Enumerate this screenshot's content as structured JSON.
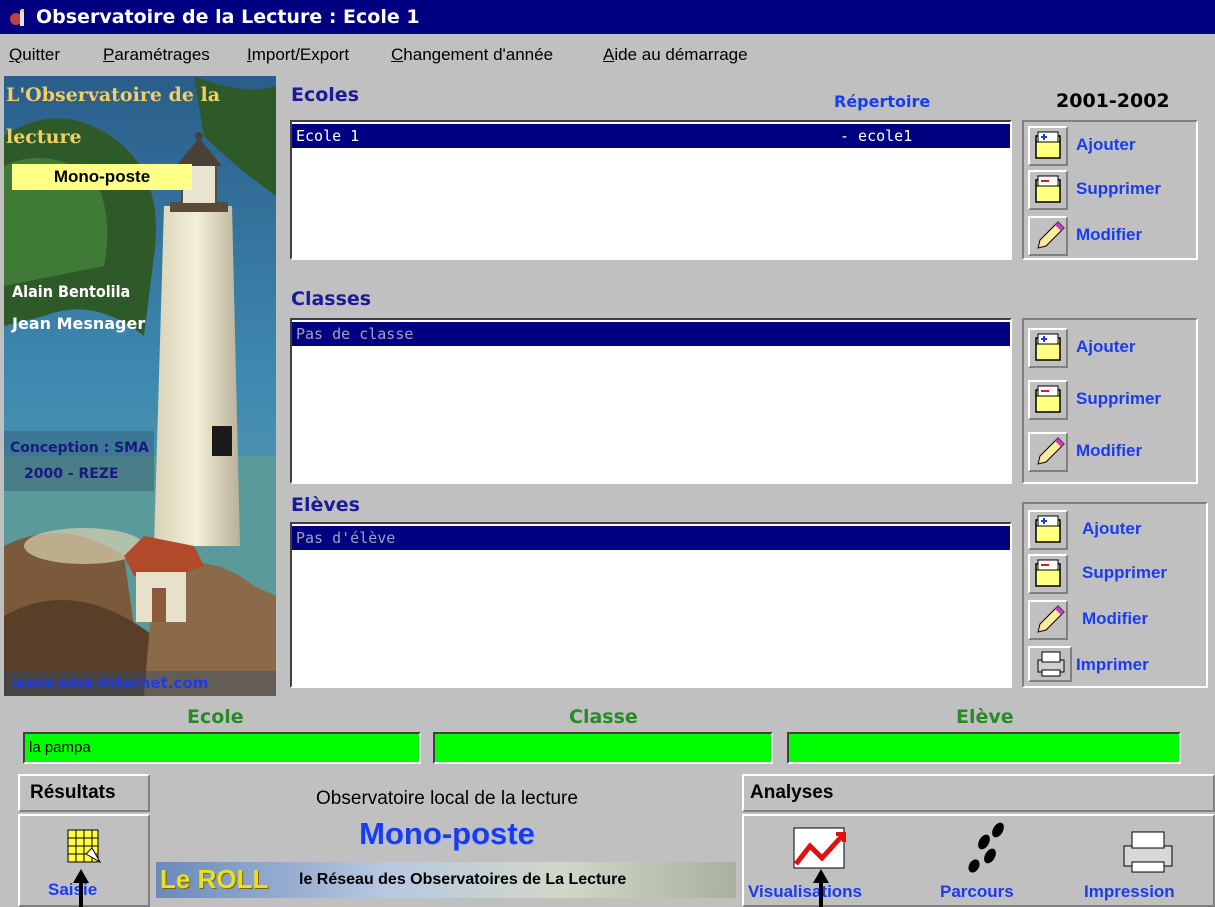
{
  "window": {
    "title": "Observatoire de la Lecture : Ecole 1"
  },
  "menu": [
    "Quitter",
    "Paramétrages",
    "Import/Export",
    "Changement d'année",
    "Aide au démarrage"
  ],
  "sidebar": {
    "title_line1": "L'Observatoire de la",
    "title_line2": "lecture",
    "badge": "Mono-poste",
    "author1": "Alain Bentolila",
    "author2": "Jean Mesnager",
    "conception_line1": "Conception : SMA",
    "conception_line2": "2000 - REZE",
    "website": "www.sma-internet.com"
  },
  "year": "2001-2002",
  "ecoles": {
    "title": "Ecoles",
    "column_label": "Répertoire",
    "rows": [
      {
        "name": "Ecole 1",
        "dir": "- ecole1"
      }
    ],
    "buttons": {
      "add": "Ajouter",
      "delete": "Supprimer",
      "edit": "Modifier"
    }
  },
  "classes": {
    "title": "Classes",
    "rows": [
      {
        "name": "Pas de classe"
      }
    ],
    "buttons": {
      "add": "Ajouter",
      "delete": "Supprimer",
      "edit": "Modifier"
    }
  },
  "eleves": {
    "title": "Elèves",
    "rows": [
      {
        "name": "Pas d'élève"
      }
    ],
    "buttons": {
      "add": "Ajouter",
      "delete": "Supprimer",
      "edit": "Modifier",
      "print": "Imprimer"
    }
  },
  "selection": {
    "ecole_label": "Ecole",
    "ecole_value": "la pampa",
    "classe_label": "Classe",
    "classe_value": "",
    "eleve_label": "Elève",
    "eleve_value": ""
  },
  "resultats": {
    "title": "Résultats",
    "saisie": "Saisie"
  },
  "center": {
    "heading": "Observatoire local de la lecture",
    "mode": "Mono-poste",
    "banner_logo": "Le ROLL",
    "banner_text": "le Réseau des Observatoires de La Lecture"
  },
  "analyses": {
    "title": "Analyses",
    "visualisations": "Visualisations",
    "parcours": "Parcours",
    "impression": "Impression"
  },
  "colors": {
    "titlebar": "#000080",
    "link_blue": "#1a3cf0",
    "field_green": "#00ff00",
    "label_green": "#2a8a2a"
  }
}
